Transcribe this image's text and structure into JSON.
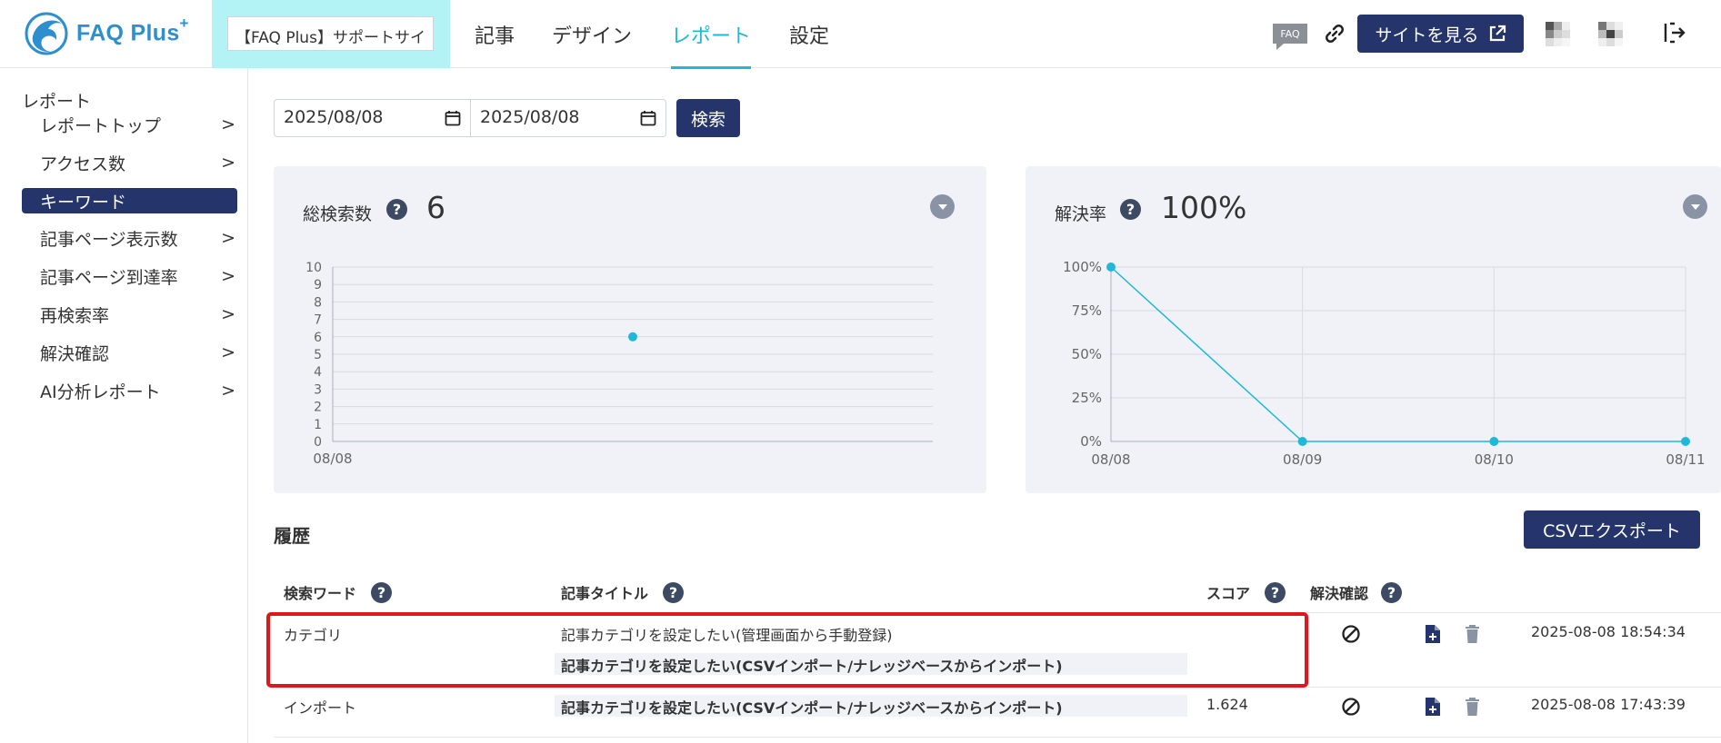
{
  "header": {
    "logo_text": "FAQ Plus",
    "logo_sup": "+",
    "site_selector": "【FAQ Plus】サポートサイ",
    "nav": [
      {
        "label": "記事"
      },
      {
        "label": "デザイン"
      },
      {
        "label": "レポート",
        "active": true
      },
      {
        "label": "設定"
      }
    ],
    "faq_badge": "FAQ",
    "view_site_label": "サイトを見る",
    "accent_color": "#1fb8d8",
    "primary_color": "#25356b"
  },
  "sidebar": {
    "title": "レポート",
    "chevron": ">",
    "items": [
      {
        "label": "レポートトップ"
      },
      {
        "label": "アクセス数"
      },
      {
        "label": "キーワード",
        "active": true
      },
      {
        "label": "記事ページ表示数"
      },
      {
        "label": "記事ページ到達率"
      },
      {
        "label": "再検索率"
      },
      {
        "label": "解決確認"
      },
      {
        "label": "AI分析レポート"
      }
    ]
  },
  "filter": {
    "start_date": "2025/08/08",
    "end_date": "2025/08/08",
    "search_label": "検索"
  },
  "cards": [
    {
      "title": "総検索数",
      "value": "6",
      "chart_data": {
        "type": "scatter",
        "x": [
          "08/08"
        ],
        "values": [
          6
        ],
        "ylim": [
          0,
          10
        ],
        "yticks": [
          "0",
          "1",
          "2",
          "3",
          "4",
          "5",
          "6",
          "7",
          "8",
          "9",
          "10"
        ],
        "grid": true,
        "color": "#1fb8d8"
      }
    },
    {
      "title": "解決率",
      "value": "100%",
      "chart_data": {
        "type": "line",
        "x": [
          "08/08",
          "08/09",
          "08/10",
          "08/11"
        ],
        "values": [
          100,
          0,
          0,
          0
        ],
        "ylim": [
          0,
          100
        ],
        "yticks": [
          "0%",
          "25%",
          "50%",
          "75%",
          "100%"
        ],
        "grid": true,
        "color": "#1fb8d8"
      }
    }
  ],
  "history": {
    "title": "履歴",
    "csv_label": "CSVエクスポート",
    "columns": {
      "keyword": "検索ワード",
      "article_title": "記事タイトル",
      "score": "スコア",
      "resolution": "解決確認"
    },
    "help_glyph": "?",
    "rows": [
      {
        "keyword": "カテゴリ",
        "titles": [
          "記事カテゴリを設定したい(管理画面から手動登録)",
          "記事カテゴリを設定したい(CSVインポート/ナレッジベースからインポート)"
        ],
        "score": "",
        "timestamp": "2025-08-08 18:54:34"
      },
      {
        "keyword": "インポート",
        "titles": [
          "記事カテゴリを設定したい(CSVインポート/ナレッジベースからインポート)"
        ],
        "score": "1.624",
        "timestamp": "2025-08-08 17:43:39"
      }
    ]
  }
}
